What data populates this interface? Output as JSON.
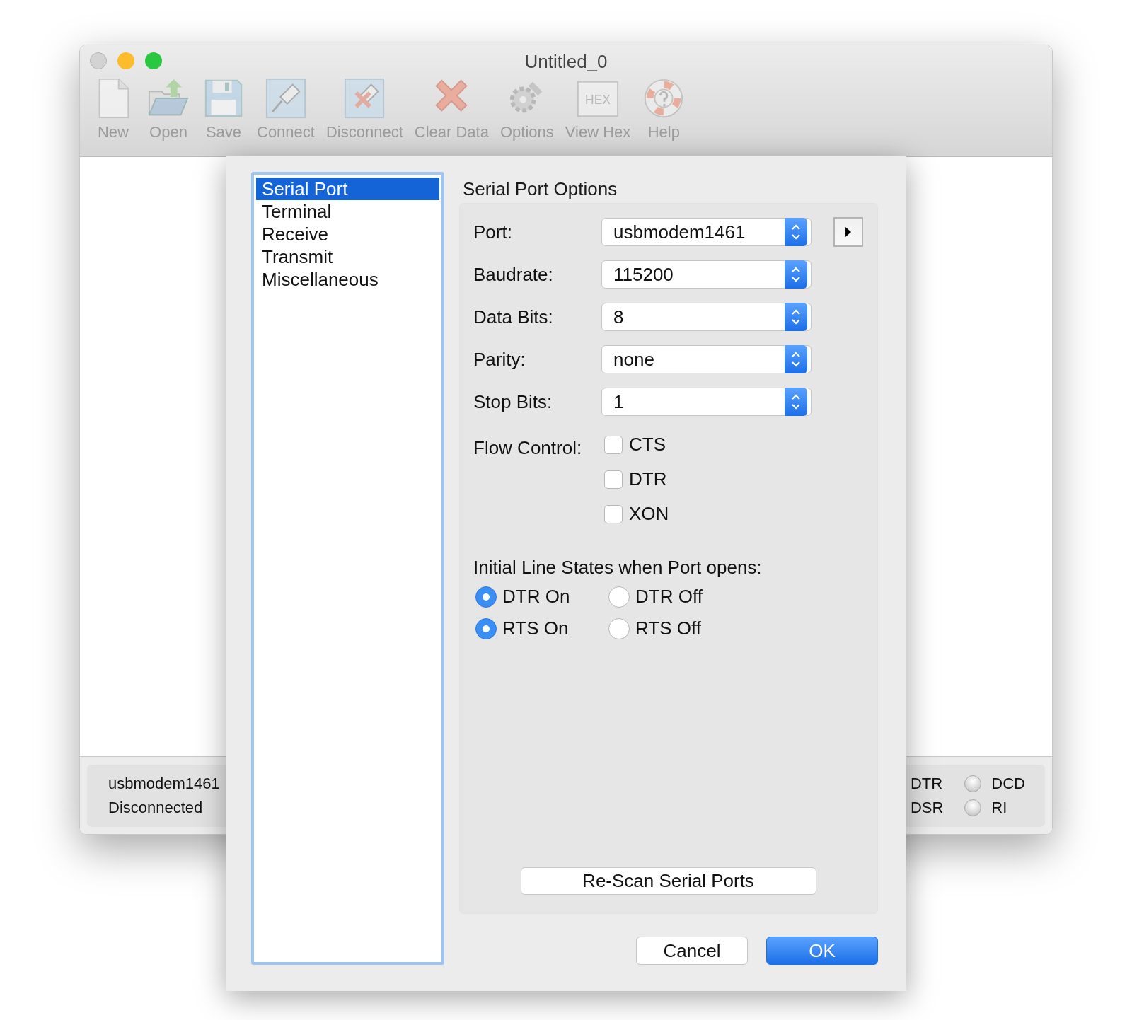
{
  "window": {
    "title": "Untitled_0"
  },
  "toolbar": [
    {
      "label": "New",
      "kind": "new"
    },
    {
      "label": "Open",
      "kind": "open"
    },
    {
      "label": "Save",
      "kind": "save"
    },
    {
      "label": "Connect",
      "kind": "connect"
    },
    {
      "label": "Disconnect",
      "kind": "disconnect"
    },
    {
      "label": "Clear Data",
      "kind": "clear"
    },
    {
      "label": "Options",
      "kind": "options"
    },
    {
      "label": "View Hex",
      "kind": "hex",
      "icon_text": "HEX"
    },
    {
      "label": "Help",
      "kind": "help"
    }
  ],
  "status_bar": {
    "port": "usbmodem1461",
    "connection": "Disconnected",
    "line_labels": [
      "DTR",
      "DSR"
    ],
    "leds": [
      {
        "label": "DCD"
      },
      {
        "label": "RI"
      }
    ]
  },
  "dialog": {
    "categories": [
      {
        "label": "Serial Port",
        "selected": true
      },
      {
        "label": "Terminal",
        "selected": false
      },
      {
        "label": "Receive",
        "selected": false
      },
      {
        "label": "Transmit",
        "selected": false
      },
      {
        "label": "Miscellaneous",
        "selected": false
      }
    ],
    "title": "Serial Port Options",
    "fields": [
      {
        "label": "Port:",
        "value": "usbmodem1461"
      },
      {
        "label": "Baudrate:",
        "value": "115200"
      },
      {
        "label": "Data Bits:",
        "value": "8"
      },
      {
        "label": "Parity:",
        "value": "none"
      },
      {
        "label": "Stop Bits:",
        "value": "1"
      }
    ],
    "flow_control": {
      "label": "Flow Control:",
      "options": [
        {
          "label": "CTS",
          "checked": false
        },
        {
          "label": "DTR",
          "checked": false
        },
        {
          "label": "XON",
          "checked": false
        }
      ]
    },
    "line_states": {
      "label": "Initial Line States when Port opens:",
      "options": [
        {
          "label": "DTR On",
          "selected": true
        },
        {
          "label": "DTR Off",
          "selected": false
        },
        {
          "label": "RTS On",
          "selected": true
        },
        {
          "label": "RTS Off",
          "selected": false
        }
      ]
    },
    "rescan_button": "Re-Scan Serial Ports",
    "buttons": [
      {
        "label": "Cancel",
        "kind": "secondary"
      },
      {
        "label": "OK",
        "kind": "primary"
      }
    ]
  }
}
